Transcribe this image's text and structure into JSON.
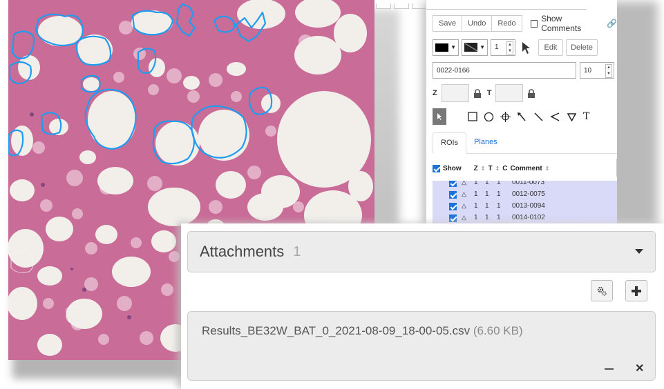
{
  "viewer": {
    "toolbar": {
      "save": "Save",
      "undo": "Undo",
      "redo": "Redo",
      "show_comments": "Show Comments",
      "edit": "Edit",
      "delete": "Delete"
    },
    "stroke_width": "1",
    "roi_name": "0022-0166",
    "font_size": "10",
    "z_label": "Z",
    "t_label": "T",
    "tabs": [
      "ROIs",
      "Planes"
    ],
    "table_header": {
      "show": "Show",
      "z": "Z",
      "t": "T",
      "c": "C",
      "comment": "Comment"
    },
    "rows": [
      {
        "z": "1",
        "t": "1",
        "c": "1",
        "comment": "0011-0073"
      },
      {
        "z": "1",
        "t": "1",
        "c": "1",
        "comment": "0012-0075"
      },
      {
        "z": "1",
        "t": "1",
        "c": "1",
        "comment": "0013-0094"
      },
      {
        "z": "1",
        "t": "1",
        "c": "1",
        "comment": "0014-0102"
      }
    ],
    "colors": {
      "roi_outline": "#1e9cf0",
      "tissue": "#c96c97",
      "selection_bg": "#d9d9f8",
      "link": "#1a73d9"
    }
  },
  "attachments": {
    "title": "Attachments",
    "count": "1",
    "file_name": "Results_BE32W_BAT_0_2021-08-09_18-00-05.csv",
    "file_size": "(6.60 KB)"
  }
}
